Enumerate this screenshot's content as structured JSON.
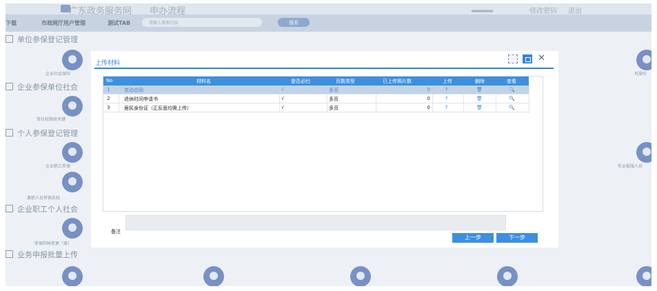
{
  "background": {
    "site_title": "广东政务服务网　　申办流程",
    "top_right": {
      "change_password": "修改密码",
      "logout": "退出"
    },
    "nav": {
      "item1": "下载",
      "item2": "市政网厅用户管理",
      "item3": "测试TAB",
      "search_placeholder": "请输入搜索内容",
      "search_button": "搜索"
    },
    "sections": [
      "单位参保登记管理",
      "企业参保单位社会",
      "个人参保登记管理",
      "企业职工个人社会",
      "业务申报批量上传"
    ],
    "tile_labels": [
      "企业社会保险",
      "单位权限续关键",
      "企业职工参保",
      "离职人员参保系统",
      "参保险种变更（增）",
      "可操作",
      "失业报服人员"
    ]
  },
  "modal": {
    "title": "上传材料",
    "columns": [
      "No",
      "材料名",
      "是否必扫",
      "页数类型",
      "已上传照片数",
      "上传",
      "删除",
      "查看"
    ],
    "rows": [
      {
        "no": "1",
        "name": "劳动合同",
        "required": "√",
        "page_type": "多页",
        "uploaded": "0",
        "selected": true
      },
      {
        "no": "2",
        "name": "退休时间申请书",
        "required": "√",
        "page_type": "多页",
        "uploaded": "0",
        "selected": false
      },
      {
        "no": "3",
        "name": "居民身份证（正反面均需上传）",
        "required": "√",
        "page_type": "多页",
        "uploaded": "0",
        "selected": false
      }
    ],
    "row_icons": {
      "upload": "↑",
      "delete": "🗑",
      "view": "🔍"
    },
    "remark_label": "备注",
    "remark_value": "",
    "prev_label": "上一步",
    "next_label": "下一步",
    "close_glyph": "✕"
  },
  "colors": {
    "accent": "#3d8fe0",
    "selected_row": "#c2d3e8",
    "overlay": "#edf1f5"
  }
}
